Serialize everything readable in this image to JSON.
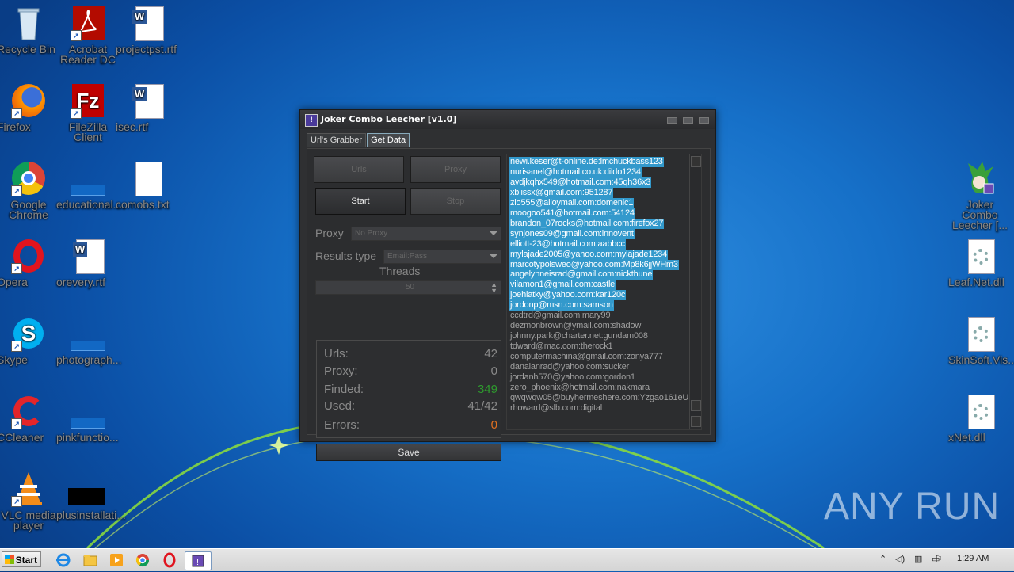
{
  "desktop": {
    "icons_left": [
      {
        "label": "Recycle Bin",
        "icon": "recycle-bin-icon"
      },
      {
        "label": "Acrobat Reader DC",
        "icon": "acrobat-icon"
      },
      {
        "label": "projectpst.rtf",
        "icon": "word-doc-icon"
      },
      {
        "label": "Firefox",
        "icon": "firefox-icon"
      },
      {
        "label": "FileZilla Client",
        "icon": "filezilla-icon"
      },
      {
        "label": "isec.rtf",
        "icon": "word-doc-icon"
      },
      {
        "label": "Google Chrome",
        "icon": "chrome-icon"
      },
      {
        "label": "educational....",
        "icon": "blank-file-icon"
      },
      {
        "label": "comobs.txt",
        "icon": "text-file-icon"
      },
      {
        "label": "Opera",
        "icon": "opera-icon"
      },
      {
        "label": "orevery.rtf",
        "icon": "word-doc-icon"
      },
      {
        "label": "Skype",
        "icon": "skype-icon"
      },
      {
        "label": "photograph...",
        "icon": "blank-file-icon"
      },
      {
        "label": "CCleaner",
        "icon": "ccleaner-icon"
      },
      {
        "label": "pinkfunctio...",
        "icon": "blank-file-icon"
      },
      {
        "label": "VLC media player",
        "icon": "vlc-icon"
      },
      {
        "label": "plusinstallati...",
        "icon": "black-file-icon"
      }
    ],
    "icons_right": [
      {
        "label": "Joker Combo Leecher [...",
        "icon": "joker-icon"
      },
      {
        "label": "Leaf.Net.dll",
        "icon": "dll-icon"
      },
      {
        "label": "SkinSoft.Vis...",
        "icon": "dll-icon"
      },
      {
        "label": "xNet.dll",
        "icon": "dll-icon"
      }
    ],
    "watermark": "ANY RUN"
  },
  "window": {
    "title": "Joker Combo Leecher [v1.0]",
    "tabs": [
      "Url's Grabber",
      "Get Data"
    ],
    "active_tab": "Get Data",
    "buttons": {
      "urls": "Urls",
      "proxy": "Proxy",
      "start": "Start",
      "stop": "Stop",
      "save": "Save"
    },
    "proxy_label": "Proxy",
    "proxy_value": "No Proxy",
    "results_type_label": "Results type",
    "results_type_value": "Email:Pass",
    "threads_label": "Threads",
    "threads_value": "50",
    "stats": {
      "urls_label": "Urls:",
      "urls_value": "42",
      "proxy_label": "Proxy:",
      "proxy_value": "0",
      "finded_label": "Finded:",
      "finded_value": "349",
      "used_label": "Used:",
      "used_value": "41/42",
      "errors_label": "Errors:",
      "errors_value": "0"
    },
    "results": [
      {
        "text": "newi.keser@t-online.de:lmchuckbass123",
        "selected": true
      },
      {
        "text": "nurisanel@hotmail.co.uk:dildo1234",
        "selected": true
      },
      {
        "text": "avdjkqhx549@hotmail.com:45qh36x3",
        "selected": true
      },
      {
        "text": "xblissx@gmail.com:951287",
        "selected": true
      },
      {
        "text": "zio555@alloymail.com:domenic1",
        "selected": true
      },
      {
        "text": "moogoo541@hotmail.com:54124",
        "selected": true
      },
      {
        "text": "brandon_07rocks@hotmail.com:firefox27",
        "selected": true
      },
      {
        "text": "synjones09@gmail.com:innovent",
        "selected": true
      },
      {
        "text": "elliott-23@hotmail.com:aabbcc",
        "selected": true
      },
      {
        "text": "mylajade2005@yahoo.com:mylajade1234",
        "selected": true
      },
      {
        "text": "marcotypolsweo@yahoo.com:Mp8k6jjWHm3",
        "selected": true
      },
      {
        "text": "angelynneisrad@gmail.com:nickthune",
        "selected": true
      },
      {
        "text": "vilamon1@gmail.com:castle",
        "selected": true
      },
      {
        "text": "joehlatky@yahoo.com:kar120c",
        "selected": true
      },
      {
        "text": "jordonp@msn.com:samson",
        "selected": true
      },
      {
        "text": "ccdtrd@gmail.com:mary99",
        "selected": false
      },
      {
        "text": "dezmonbrown@ymail.com:shadow",
        "selected": false
      },
      {
        "text": "johnny.park@charter.net:gundam008",
        "selected": false
      },
      {
        "text": "tdward@mac.com:therock1",
        "selected": false
      },
      {
        "text": "computermachina@gmail.com:zonya777",
        "selected": false
      },
      {
        "text": "danalanrad@yahoo.com:sucker",
        "selected": false
      },
      {
        "text": "jordanh570@yahoo.com:gordon1",
        "selected": false
      },
      {
        "text": "zero_phoenix@hotmail.com:nakmara",
        "selected": false
      },
      {
        "text": "qwqwqw05@buyhermeshere.com:Yzgao161eU",
        "selected": false
      },
      {
        "text": "rhoward@slb.com:digital",
        "selected": false
      }
    ]
  },
  "taskbar": {
    "start_label": "Start",
    "clock": "1:29 AM",
    "apps": [
      "ie-icon",
      "explorer-icon",
      "media-player-icon",
      "chrome-icon",
      "opera-icon",
      "joker-icon"
    ]
  },
  "colors": {
    "selection": "#3399cc",
    "finded_green": "#2e9a2e",
    "errors_orange": "#e07020"
  }
}
